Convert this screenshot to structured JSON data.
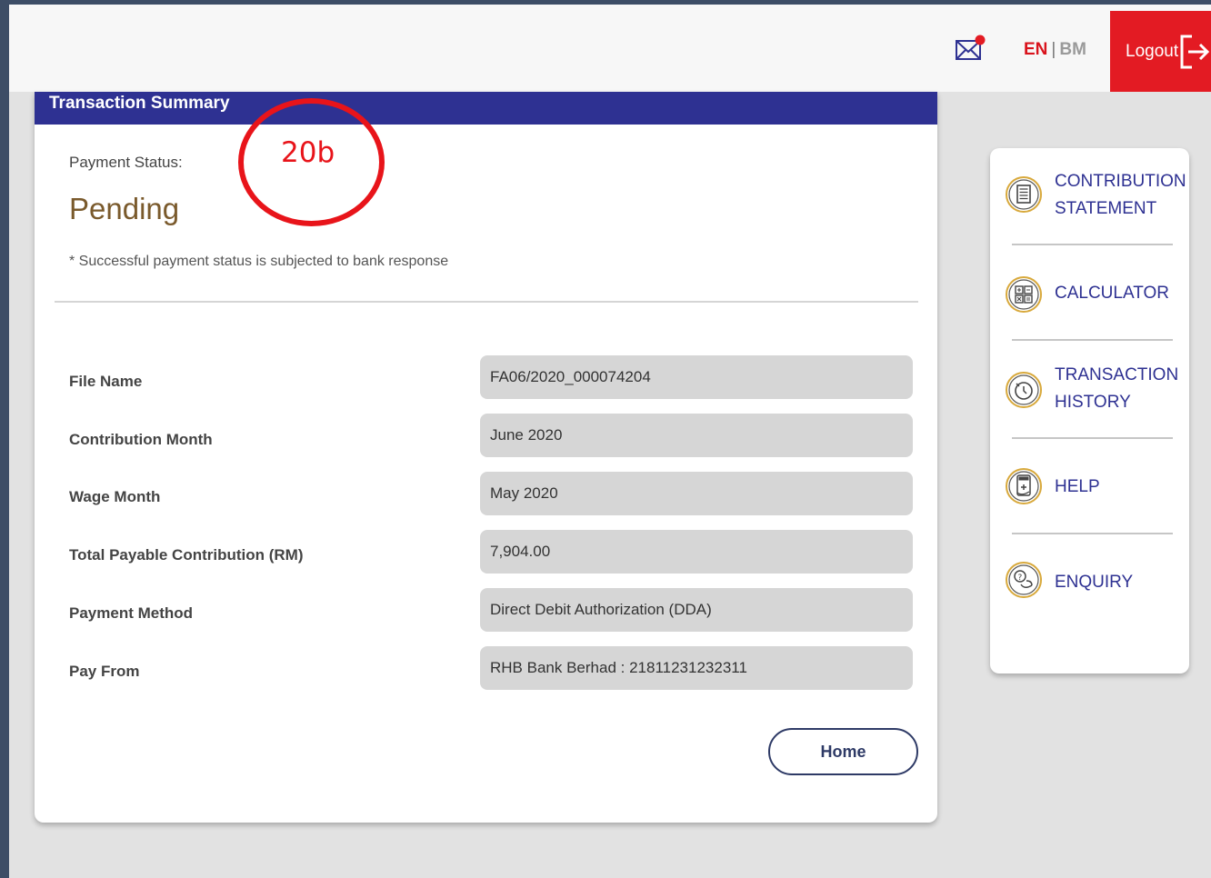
{
  "topbar": {
    "lang_en": "EN",
    "lang_sep": "|",
    "lang_bm": "BM",
    "logout_label": "Logout",
    "accent": "#e31b23"
  },
  "summary": {
    "header": "Transaction Summary",
    "status_label": "Payment Status:",
    "status_value": "Pending",
    "note": "* Successful payment status is subjected to bank response",
    "rows": [
      {
        "label": "File Name",
        "value": "FA06/2020_000074204"
      },
      {
        "label": "Contribution Month",
        "value": "June 2020"
      },
      {
        "label": "Wage Month",
        "value": "May 2020"
      },
      {
        "label": "Total Payable Contribution (RM)",
        "value": "7,904.00"
      },
      {
        "label": "Payment Method",
        "value": "Direct Debit Authorization (DDA)"
      },
      {
        "label": "Pay From",
        "value": "RHB Bank Berhad : 21811231232311"
      }
    ],
    "home_label": "Home",
    "header_color": "#2e3192"
  },
  "annotation": {
    "text": "20b",
    "color": "#e8141a"
  },
  "sidebar": {
    "items": [
      {
        "line1": "CONTRIBUTION",
        "line2": "STATEMENT",
        "icon": "document-icon"
      },
      {
        "line1": "CALCULATOR",
        "line2": "",
        "icon": "calculator-icon"
      },
      {
        "line1": "TRANSACTION",
        "line2": "HISTORY",
        "icon": "history-clock-icon"
      },
      {
        "line1": "HELP",
        "line2": "",
        "icon": "help-icon"
      },
      {
        "line1": "ENQUIRY",
        "line2": "",
        "icon": "enquiry-icon"
      }
    ]
  }
}
